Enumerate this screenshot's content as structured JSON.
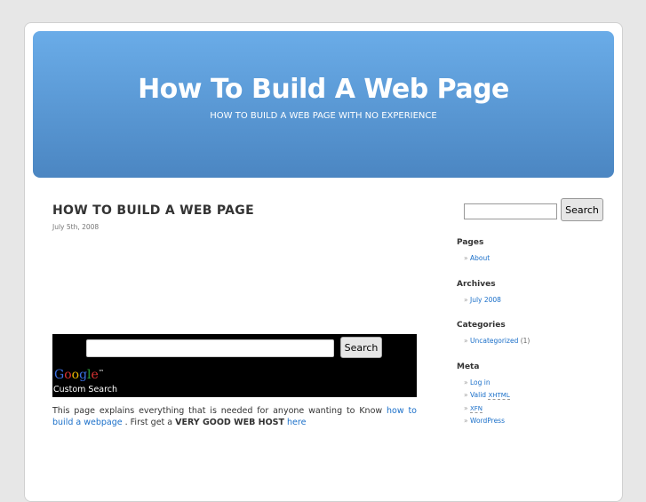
{
  "header": {
    "title": "How To Build A Web Page",
    "description": "HOW TO BUILD A WEB PAGE WITH NO EXPERIENCE"
  },
  "post": {
    "title": "HOW TO BUILD A WEB PAGE",
    "date": "July 5th, 2008",
    "google_search": {
      "button": "Search",
      "logo": "Google",
      "tm": "™",
      "caption": "Custom Search"
    },
    "body": {
      "text1": "This page explains everything that is needed for anyone wanting to Know ",
      "link1": "how to build a webpage",
      "text2": " . First get a ",
      "bold": "VERY GOOD WEB HOST",
      "link2": "here"
    }
  },
  "sidebar": {
    "search_button": "Search",
    "pages": {
      "title": "Pages",
      "items": [
        "About"
      ]
    },
    "archives": {
      "title": "Archives",
      "items": [
        "July 2008"
      ]
    },
    "categories": {
      "title": "Categories",
      "item": "Uncategorized",
      "count": "(1)"
    },
    "meta": {
      "title": "Meta",
      "login": "Log in",
      "valid": "Valid ",
      "xhtml": "XHTML",
      "xfn": "XFN",
      "wordpress": "WordPress"
    }
  }
}
